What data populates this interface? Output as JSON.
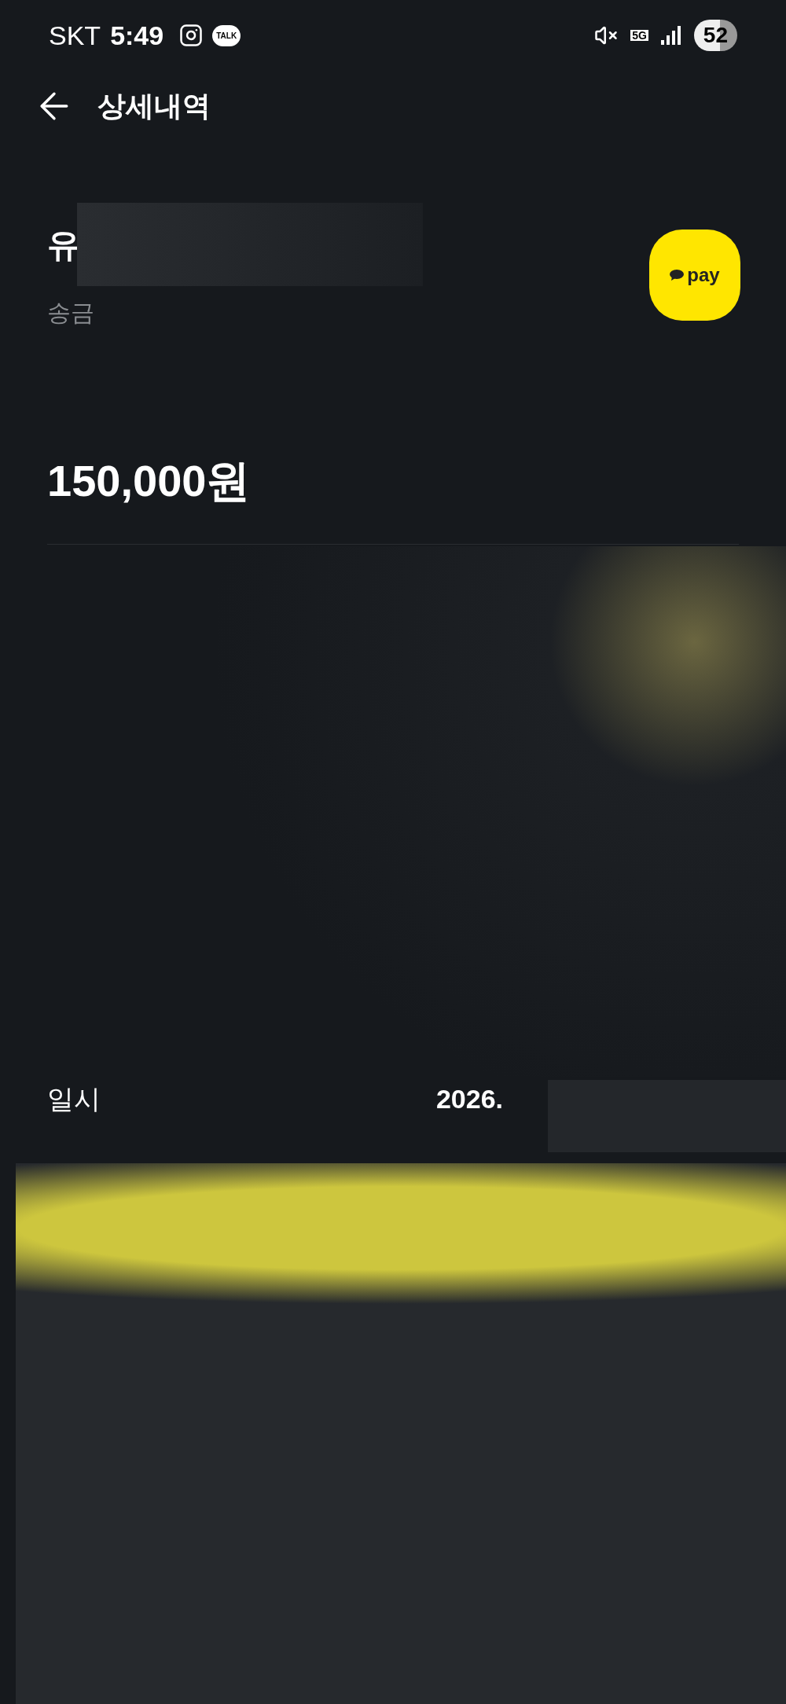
{
  "status_bar": {
    "carrier": "SKT",
    "time": "5:49",
    "talk_badge": "TALK",
    "network": "5G",
    "battery": "52"
  },
  "header": {
    "title": "상세내역"
  },
  "transaction": {
    "name": "유",
    "type": "송금",
    "logo_text": "pay",
    "amount": "150,000원"
  },
  "details": [
    {
      "label": "일시",
      "value": "2026."
    }
  ]
}
